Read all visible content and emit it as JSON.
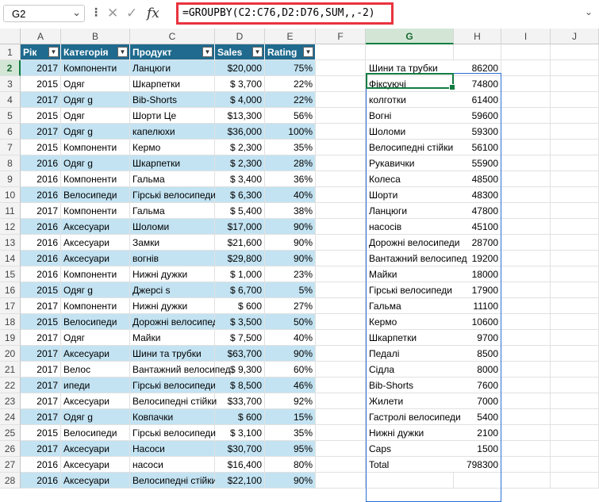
{
  "formula_bar": {
    "cell_ref": "G2",
    "formula": "=GROUPBY(C2:C76,D2:D76,SUM,,-2)",
    "fx_label": "fx"
  },
  "columns": [
    "A",
    "B",
    "C",
    "D",
    "E",
    "F",
    "G",
    "H",
    "I",
    "J"
  ],
  "selected_column": "G",
  "selected_row": 2,
  "row_numbers": [
    1,
    2,
    3,
    4,
    5,
    6,
    7,
    8,
    9,
    10,
    11,
    12,
    13,
    14,
    15,
    16,
    17,
    18,
    19,
    20,
    21,
    22,
    23,
    24,
    25,
    26,
    27,
    28
  ],
  "table": {
    "headers": [
      "Рік",
      "Категорія",
      "Продукт",
      "Sales",
      "Rating"
    ],
    "rows": [
      [
        "2017",
        "Компоненти",
        "Ланцюги",
        "$20,000",
        "75%"
      ],
      [
        "2015",
        "Одяг",
        "Шкарпетки",
        "$  3,700",
        "22%"
      ],
      [
        "2017",
        "Одяг       g",
        "Bib-Shorts",
        "$  4,000",
        "22%"
      ],
      [
        "2015",
        "Одяг",
        "Шорти Це",
        "$13,300",
        "56%"
      ],
      [
        "2017",
        "Одяг       g",
        "капелюхи",
        "$36,000",
        "100%"
      ],
      [
        "2015",
        "Компоненти",
        "Кермо",
        "$  2,300",
        "35%"
      ],
      [
        "2016",
        "Одяг       g",
        "Шкарпетки",
        "$  2,300",
        "28%"
      ],
      [
        "2016",
        "Компоненти",
        "Гальма",
        "$  3,400",
        "36%"
      ],
      [
        "2016",
        "Велосипеди",
        "Гірські велосипеди",
        "$  6,300",
        "40%"
      ],
      [
        "2017",
        "Компоненти",
        "Гальма",
        "$  5,400",
        "38%"
      ],
      [
        "2016",
        "Аксесуари",
        "Шоломи",
        "$17,000",
        "90%"
      ],
      [
        "2016",
        "Аксесуари",
        "Замки",
        "$21,600",
        "90%"
      ],
      [
        "2016",
        "Аксесуари",
        "вогнів",
        "$29,800",
        "90%"
      ],
      [
        "2016",
        "Компоненти",
        "Нижні дужки",
        "$  1,000",
        "23%"
      ],
      [
        "2015",
        "Одяг       g",
        "Джерсі s",
        "$  6,700",
        "5%"
      ],
      [
        "2017",
        "Компоненти",
        "Нижні дужки",
        "$     600",
        "27%"
      ],
      [
        "2015",
        "Велосипеди",
        "Дорожні велосипеди",
        "$  3,500",
        "50%"
      ],
      [
        "2017",
        "Одяг",
        "Майки",
        "$  7,500",
        "40%"
      ],
      [
        "2017",
        "Аксесуари",
        "Шини та трубки",
        "$63,700",
        "90%"
      ],
      [
        "2017",
        "Велос",
        "Вантажний велосипед",
        "$  9,300",
        "60%"
      ],
      [
        "2017",
        "ипеди",
        "Гірські велосипеди",
        "$  8,500",
        "46%"
      ],
      [
        "2017",
        "Аксесуари",
        "Велосипедні стійки",
        "$33,700",
        "92%"
      ],
      [
        "2017",
        "Одяг       g",
        "Ковпачки",
        "$     600",
        "15%"
      ],
      [
        "2015",
        "Велосипеди",
        "Гірські велосипеди",
        "$  3,100",
        "35%"
      ],
      [
        "2017",
        "Аксесуари",
        "Насоси",
        "$30,700",
        "95%"
      ],
      [
        "2016",
        "Аксесуари",
        "насоси",
        "$16,400",
        "80%"
      ],
      [
        "2016",
        "Аксесуари",
        "Велосипедні стійки",
        "$22,100",
        "90%"
      ]
    ]
  },
  "groupby": [
    [
      "Шини та трубки",
      "86200"
    ],
    [
      "Фіксуючі",
      "74800"
    ],
    [
      "колготки",
      "61400"
    ],
    [
      "Вогні",
      "59600"
    ],
    [
      "Шоломи",
      "59300"
    ],
    [
      "Велосипедні стійки",
      "56100"
    ],
    [
      "Рукавички",
      "55900"
    ],
    [
      "Колеса",
      "48500"
    ],
    [
      "Шорти",
      "48300"
    ],
    [
      "Ланцюги",
      "47800"
    ],
    [
      "насосів",
      "45100"
    ],
    [
      "Дорожні велосипеди",
      "28700"
    ],
    [
      "Вантажний велосипед",
      "19200"
    ],
    [
      "Майки",
      "18000"
    ],
    [
      "Гірські велосипеди",
      "17900"
    ],
    [
      "Гальма",
      "11100"
    ],
    [
      "Кермо",
      "10600"
    ],
    [
      "Шкарпетки",
      "9700"
    ],
    [
      "Педалі",
      "8500"
    ],
    [
      "Сідла",
      "8000"
    ],
    [
      "Bib-Shorts",
      "7600"
    ],
    [
      "Жилети",
      "7000"
    ],
    [
      "Гастролі велосипеди",
      "5400"
    ],
    [
      "Нижні дужки",
      "2100"
    ],
    [
      "Caps",
      "1500"
    ],
    [
      "Total",
      "798300"
    ]
  ],
  "colors": {
    "header": "#1f6a8e",
    "band": "#c3e3f2",
    "selection": "#107c41",
    "formula_highlight": "#e8333d",
    "spill_border": "#2a6fd6"
  }
}
